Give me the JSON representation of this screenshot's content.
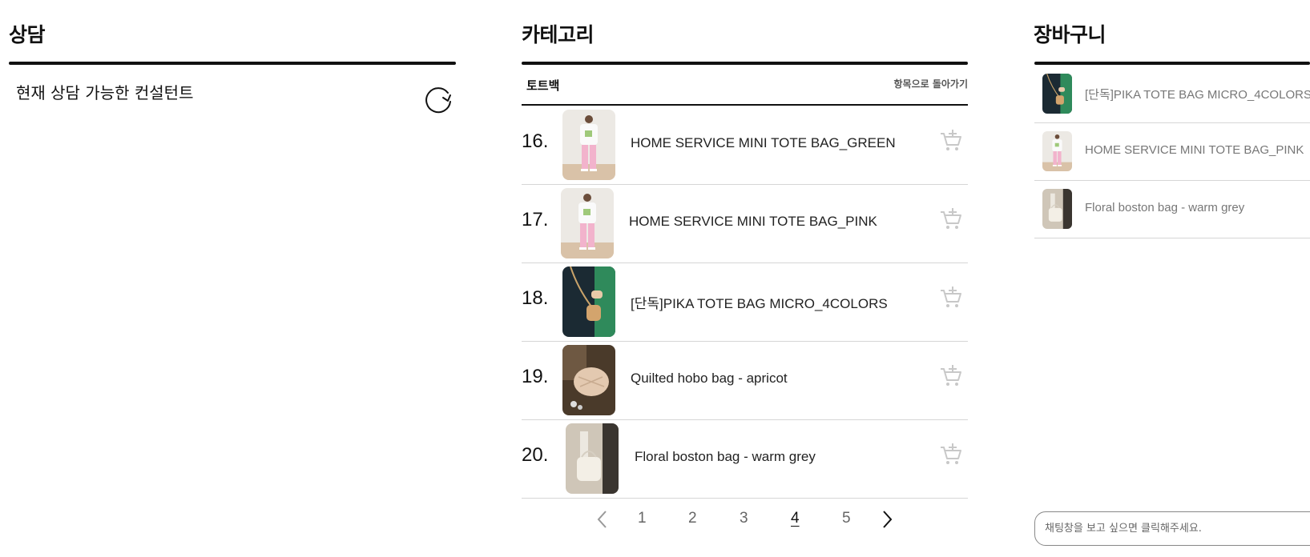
{
  "consult": {
    "title": "상담",
    "status_text": "현재 상담 가능한 컨설턴트",
    "refresh_icon": "refresh-icon"
  },
  "category": {
    "title": "카테고리",
    "current": "토트백",
    "back_label": "항목으로 돌아가기",
    "products": [
      {
        "num": "16.",
        "name": "HOME SERVICE MINI TOTE BAG_GREEN",
        "thumb": "white-tee-pink-pants"
      },
      {
        "num": "17.",
        "name": "HOME SERVICE MINI TOTE BAG_PINK",
        "thumb": "white-tee-pink-pants"
      },
      {
        "num": "18.",
        "name": "[단독]PIKA TOTE BAG MICRO_4COLORS",
        "thumb": "dark-green-tote"
      },
      {
        "num": "19.",
        "name": "Quilted hobo bag - apricot",
        "thumb": "quilted-hobo"
      },
      {
        "num": "20.",
        "name": "Floral boston bag - warm grey",
        "thumb": "boston-bag"
      }
    ],
    "pages": [
      "1",
      "2",
      "3",
      "4",
      "5"
    ],
    "current_page": "4"
  },
  "cart": {
    "title": "장바구니",
    "items": [
      {
        "name": "[단독]PIKA TOTE BAG MICRO_4COLORS",
        "thumb": "dark-green-tote"
      },
      {
        "name": "HOME SERVICE MINI TOTE BAG_PINK",
        "thumb": "white-tee-pink-pants"
      },
      {
        "name": "Floral boston bag - warm grey",
        "thumb": "boston-bag"
      }
    ]
  },
  "chat": {
    "placeholder": "채팅창을 보고 싶으면 클릭해주세요."
  }
}
